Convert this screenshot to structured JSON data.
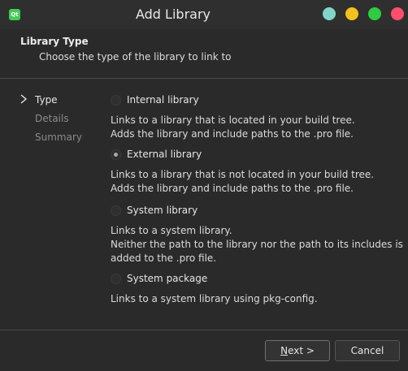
{
  "window": {
    "title": "Add Library",
    "icon": "qt-icon",
    "controls": [
      "help",
      "minimize",
      "maximize",
      "close"
    ],
    "colors": {
      "help": "#7fd6c9",
      "minimize": "#f4c01e",
      "maximize": "#2ecc40",
      "close": "#ff4f6d"
    }
  },
  "header": {
    "title": "Library Type",
    "subtitle": "Choose the type of the library to link to"
  },
  "nav": {
    "items": [
      {
        "label": "Type",
        "active": true
      },
      {
        "label": "Details",
        "active": false
      },
      {
        "label": "Summary",
        "active": false
      }
    ]
  },
  "options": [
    {
      "label": "Internal library",
      "checked": false,
      "description": [
        "Links to a library that is located in your build tree.",
        "Adds the library and include paths to the .pro file."
      ]
    },
    {
      "label": "External library",
      "checked": true,
      "description": [
        "Links to a library that is not located in your build tree.",
        "Adds the library and include paths to the .pro file."
      ]
    },
    {
      "label": "System library",
      "checked": false,
      "description": [
        "Links to a system library.",
        "Neither the path to the library nor the path to its includes is",
        "added to the .pro file."
      ]
    },
    {
      "label": "System package",
      "checked": false,
      "description": [
        "Links to a system library using pkg-config."
      ]
    }
  ],
  "buttons": {
    "next_mnemonic": "N",
    "next_rest": "ext >",
    "cancel": "Cancel"
  }
}
